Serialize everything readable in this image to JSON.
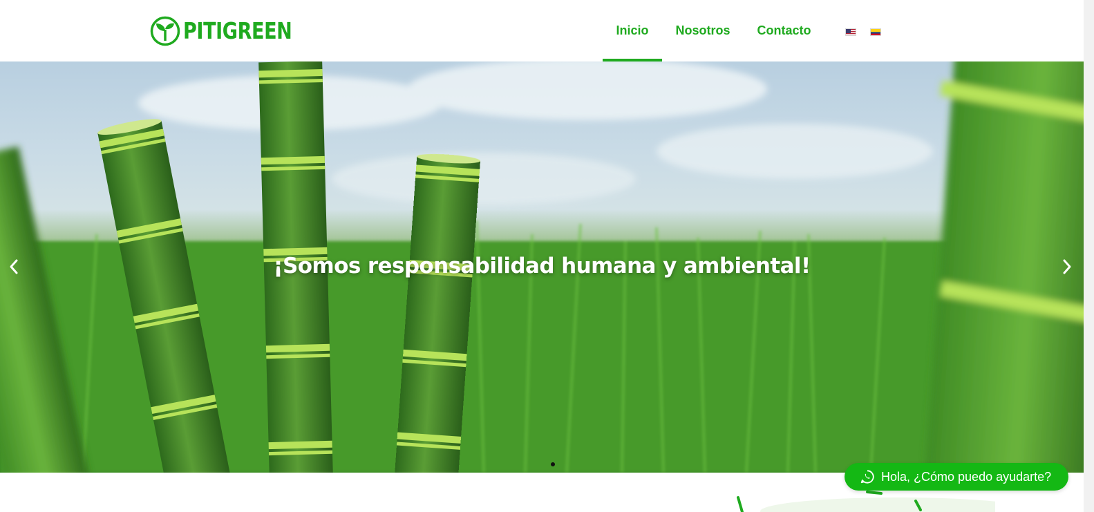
{
  "brand": {
    "name": "PITIGREEN",
    "color": "#1faa1f"
  },
  "nav": {
    "items": [
      {
        "label": "Inicio",
        "active": true
      },
      {
        "label": "Nosotros",
        "active": false
      },
      {
        "label": "Contacto",
        "active": false
      }
    ],
    "languages": [
      {
        "icon": "us-flag-icon"
      },
      {
        "icon": "colombia-flag-icon"
      }
    ]
  },
  "hero": {
    "title": "¡Somos responsabilidad humana y ambiental!",
    "prev_icon": "chevron-left-icon",
    "next_icon": "chevron-right-icon",
    "slides_total": 1,
    "current_slide": 1
  },
  "chat": {
    "label": "Hola, ¿Cómo puedo ayudarte?",
    "icon": "whatsapp-icon",
    "color": "#14b814"
  }
}
